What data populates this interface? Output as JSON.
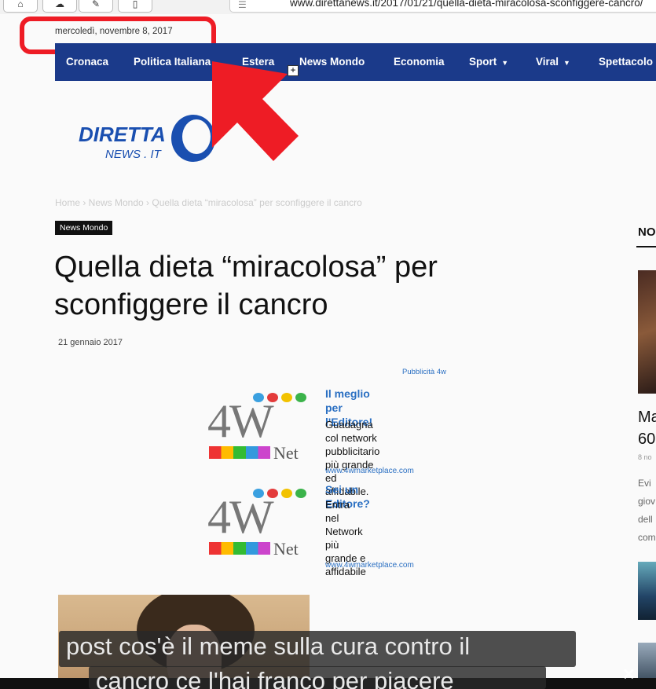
{
  "browser": {
    "url": "www.direttаnews.it/2017/01/21/quella-dieta-miracolosa-sconfiggere-cancro/",
    "icons": [
      "home-icon",
      "cloud-icon",
      "compose-icon",
      "sidebar-icon",
      "reader-icon"
    ]
  },
  "header": {
    "date": "mercoledì, novembre 8, 2017"
  },
  "nav": {
    "items": [
      {
        "label": "Cronaca"
      },
      {
        "label": "Politica Italiana"
      },
      {
        "label": "Estera"
      },
      {
        "label": "News Mondo"
      },
      {
        "label": "Economia"
      },
      {
        "label": "Sport"
      },
      {
        "label": "Viral"
      },
      {
        "label": "Spettacolo"
      }
    ],
    "plus_icon": "+"
  },
  "logo": {
    "line1": "DIRETTA",
    "line2": "NEWS . IT"
  },
  "breadcrumb": {
    "text": "Home  ›  News Mondo  ›  Quella dieta “miracolosa” per sconfiggere il cancro"
  },
  "article": {
    "category": "News Mondo",
    "title_line1": "Quella dieta “miracolosa” per",
    "title_line2": "sconfiggere il cancro",
    "date": "21 gennaio 2017"
  },
  "ad": {
    "label": "Pubblicità 4w",
    "block1": {
      "head1": "Il meglio per",
      "head2": "l'Editore!",
      "body1": "Guadagna col network",
      "body2": "pubblicitario più grande",
      "body3": "ed affidabile.",
      "link": "www.4wmarketplace.com"
    },
    "block2": {
      "head1": "Sei un Editore?",
      "body1": "Entra nel Network più",
      "body2": "grande e affidabile",
      "link": "www.4wmarketplace.com"
    },
    "logo_text": "4W",
    "logo_net": "Net",
    "dot_colors": [
      "#3aa0e0",
      "#e33b3b",
      "#f2c200",
      "#3bb34a",
      "#c040c0"
    ]
  },
  "sidebar": {
    "title": "NO",
    "headline_l1": "Ma",
    "headline_l2": "60",
    "date": "8 no",
    "text_l1": "Evi",
    "text_l2": "giov",
    "text_l3": "dell",
    "text_l4": "com"
  },
  "video": {
    "subtitle_line1": "post cos'è il meme sulla cura contro il",
    "subtitle_line2": "cancro ce l'hai franco per piacere",
    "close_label": "✕"
  }
}
